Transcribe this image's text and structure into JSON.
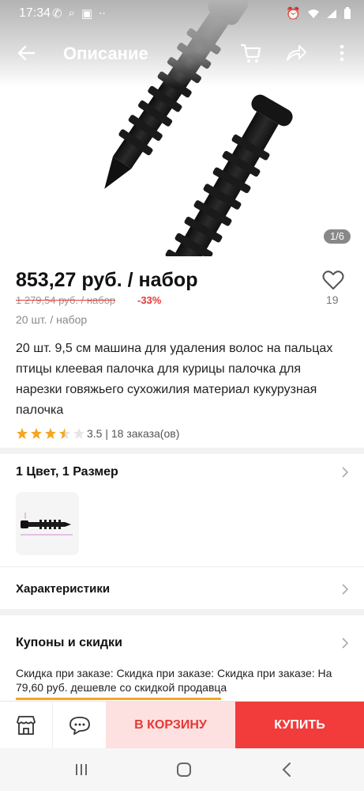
{
  "status_bar": {
    "time": "17:34"
  },
  "app_bar": {
    "title": "Описание"
  },
  "gallery": {
    "counter": "1/6"
  },
  "product": {
    "price": "853,27 руб. / набор",
    "old_price": "1 279,54 руб. / набор",
    "discount": "-33%",
    "unit": "20 шт. / набор",
    "wishlist_count": "19",
    "title": "20 шт. 9,5 см машина для удаления волос на пальцах птицы клеевая палочка для курицы палочка для нарезки говяжьего сухожилия материал кукурузная палочка",
    "rating_value": 3.5,
    "rating_text": "3.5 | 18 заказа(ов)"
  },
  "sections": {
    "variants_title": "1 Цвет, 1 Размер",
    "specs_title": "Характеристики",
    "coupons_title": "Купоны и скидки",
    "coupon_text": "Скидка при заказе: Скидка при заказе: Скидка при заказе: На 79,60 руб. дешевле со скидкой продавца"
  },
  "actions": {
    "add_to_cart": "В КОРЗИНУ",
    "buy": "КУПИТЬ"
  },
  "colors": {
    "accent_red": "#f23b3b",
    "discount_red": "#e53935",
    "cart_bg": "#fde0e0",
    "star": "#f5a623"
  }
}
